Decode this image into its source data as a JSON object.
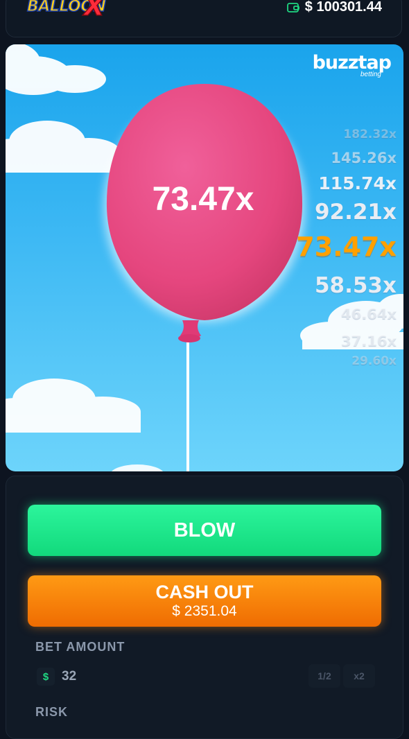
{
  "app": {
    "logo_text": "BALLOON",
    "logo_x": "X",
    "balance": "$ 100301.44"
  },
  "game": {
    "brand_main": "buzztap",
    "brand_sub": "betting",
    "balloon_multiplier": "73.47x",
    "ladder": [
      {
        "label": "182.32x",
        "state": "far"
      },
      {
        "label": "145.26x",
        "state": "faded"
      },
      {
        "label": "115.74x",
        "state": "near"
      },
      {
        "label": "92.21x",
        "state": "next"
      },
      {
        "label": "73.47x",
        "state": "current"
      },
      {
        "label": "58.53x",
        "state": "prev"
      },
      {
        "label": "46.64x",
        "state": "faded"
      },
      {
        "label": "37.16x",
        "state": "faded"
      },
      {
        "label": "29.60x",
        "state": "far"
      }
    ],
    "colors": {
      "current": "#ffa000",
      "balloon": "#e8477f"
    }
  },
  "controls": {
    "blow_label": "BLOW",
    "cashout_label": "CASH OUT",
    "cashout_amount": "$ 2351.04",
    "bet_amount_label": "BET AMOUNT",
    "currency_symbol": "$",
    "bet_value": "32",
    "half_label": "1/2",
    "double_label": "x2",
    "risk_label": "RISK"
  }
}
